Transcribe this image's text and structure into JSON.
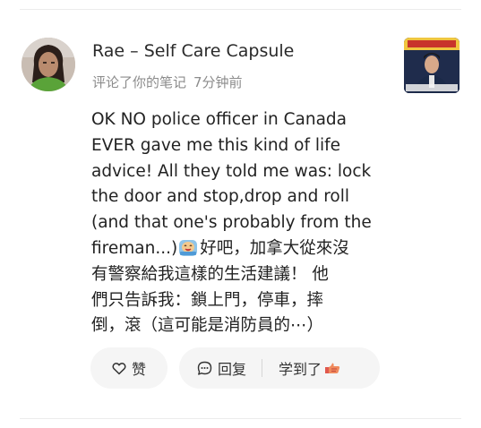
{
  "comment_card": {
    "user": {
      "name": "Rae – Self Care Capsule"
    },
    "meta": {
      "action": "评论了你的笔记",
      "time": "7分钟前"
    },
    "comment_lines": [
      "OK NO police officer in Canada",
      "EVER gave me this kind of life",
      "advice! All they told me was: lock",
      "the door and stop,drop and roll",
      "(and that one's probably from the",
      "fireman...)",
      "好吧，加拿大從來沒",
      "有警察給我這樣的生活建議！ 他",
      "們只告訴我：鎖上門，停車，摔",
      "倒，滾（這可能是消防員的⋯）"
    ],
    "actions": {
      "like_label": "赞",
      "reply_label": "回复",
      "learned_label": "学到了"
    },
    "icons": {
      "like": "heart-outline-icon",
      "reply": "speech-bubble-icon",
      "inline_emoji": "crying-laughing-emoji-icon",
      "learned_emoji": "thumbs-up-emoji-icon"
    }
  }
}
